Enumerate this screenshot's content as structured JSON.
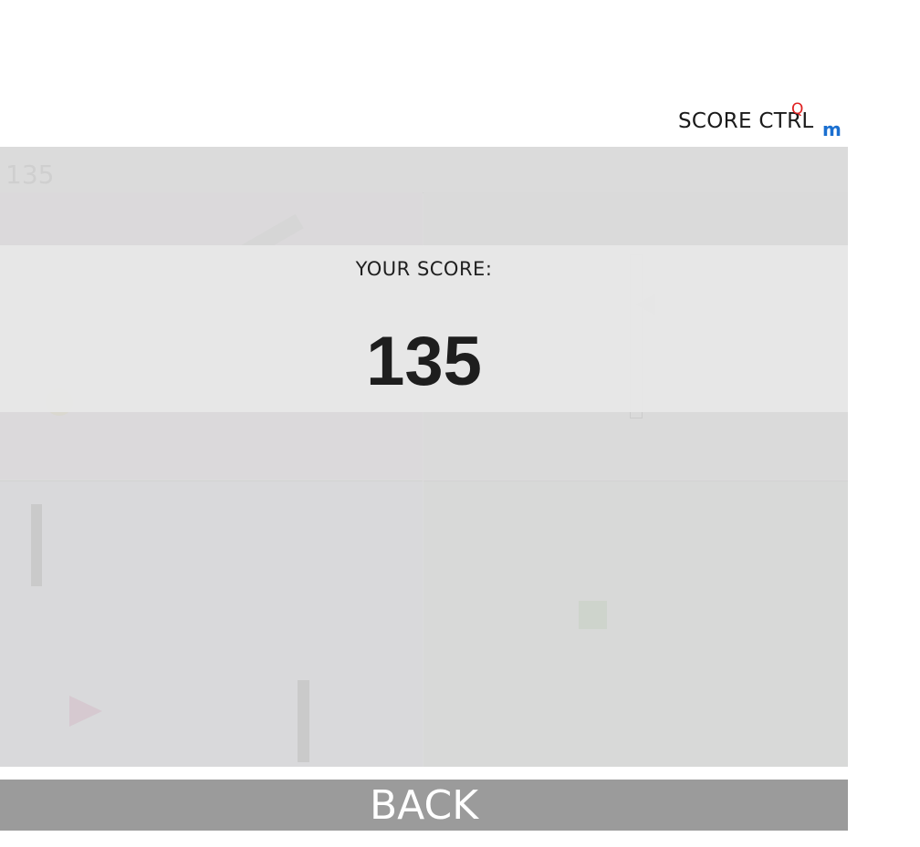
{
  "header": {
    "brand": {
      "text": "SCORE CTRL",
      "superscript": "Q",
      "subscript": "m",
      "colors": {
        "text": "#1a1a1a",
        "superscript": "#e02020",
        "subscript": "#1a6fd0"
      }
    }
  },
  "board": {
    "faded_score": "135"
  },
  "result": {
    "label": "YOUR SCORE:",
    "score": "135"
  },
  "actions": {
    "back_label": "BACK"
  }
}
